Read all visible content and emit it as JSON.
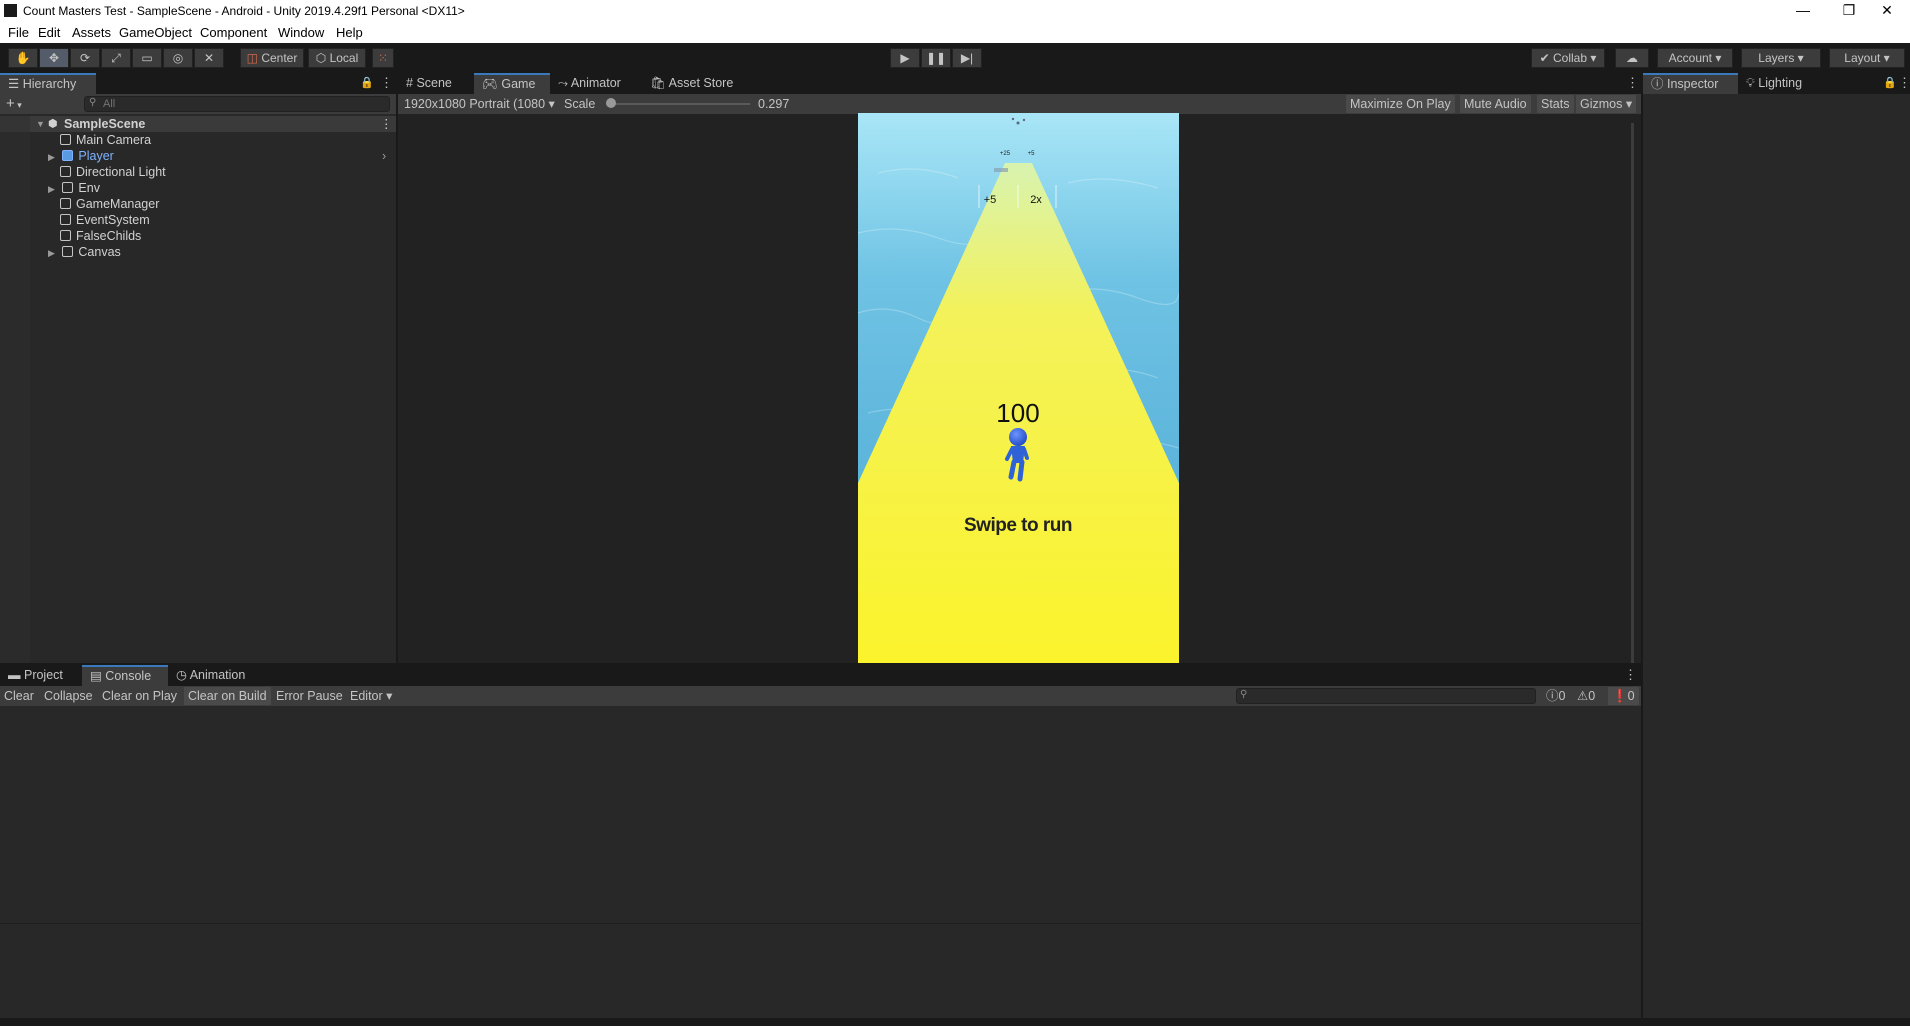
{
  "window": {
    "title": "Count Masters Test - SampleScene - Android - Unity 2019.4.29f1 Personal <DX11>",
    "controls": {
      "minimize": "—",
      "restore": "❐",
      "close": "✕"
    }
  },
  "menu": [
    "File",
    "Edit",
    "Assets",
    "GameObject",
    "Component",
    "Window",
    "Help"
  ],
  "toolbar": {
    "pivot": "Center",
    "space": "Local",
    "collab": "Collab",
    "account": "Account",
    "layers": "Layers",
    "layout": "Layout"
  },
  "hierarchy": {
    "tab": "Hierarchy",
    "add": "+",
    "search_placeholder": "All",
    "scene": "SampleScene",
    "items": [
      "Main Camera",
      "Player",
      "Directional Light",
      "Env",
      "GameManager",
      "EventSystem",
      "FalseChilds",
      "Canvas"
    ]
  },
  "center_tabs": [
    "Scene",
    "Game",
    "Animator",
    "Asset Store"
  ],
  "game_bar": {
    "resolution": "1920x1080 Portrait (1080",
    "scale_label": "Scale",
    "scale_value": "0.297",
    "scale_fraction": 0.0,
    "maximize": "Maximize On Play",
    "mute": "Mute Audio",
    "stats": "Stats",
    "gizmos": "Gizmos"
  },
  "game_view": {
    "gate_left": "+5",
    "gate_right": "2x",
    "far_gate_left": "+25",
    "far_gate_right": "+5",
    "count": "100",
    "prompt": "Swipe to run",
    "colors": {
      "sky": "#8fd9f0",
      "water": "#5fb6dd",
      "road": "#f7f232",
      "player": "#2f62d6"
    }
  },
  "right_tabs": [
    "Inspector",
    "Lighting"
  ],
  "bottom_tabs": [
    "Project",
    "Console",
    "Animation"
  ],
  "console_bar": {
    "buttons": [
      "Clear",
      "Collapse",
      "Clear on Play",
      "Clear on Build",
      "Error Pause",
      "Editor"
    ],
    "info_count": "0",
    "warn_count": "0",
    "error_count": "0"
  },
  "colors": {
    "accent": "#3a79bb",
    "player_text": "#7fb3ff"
  }
}
